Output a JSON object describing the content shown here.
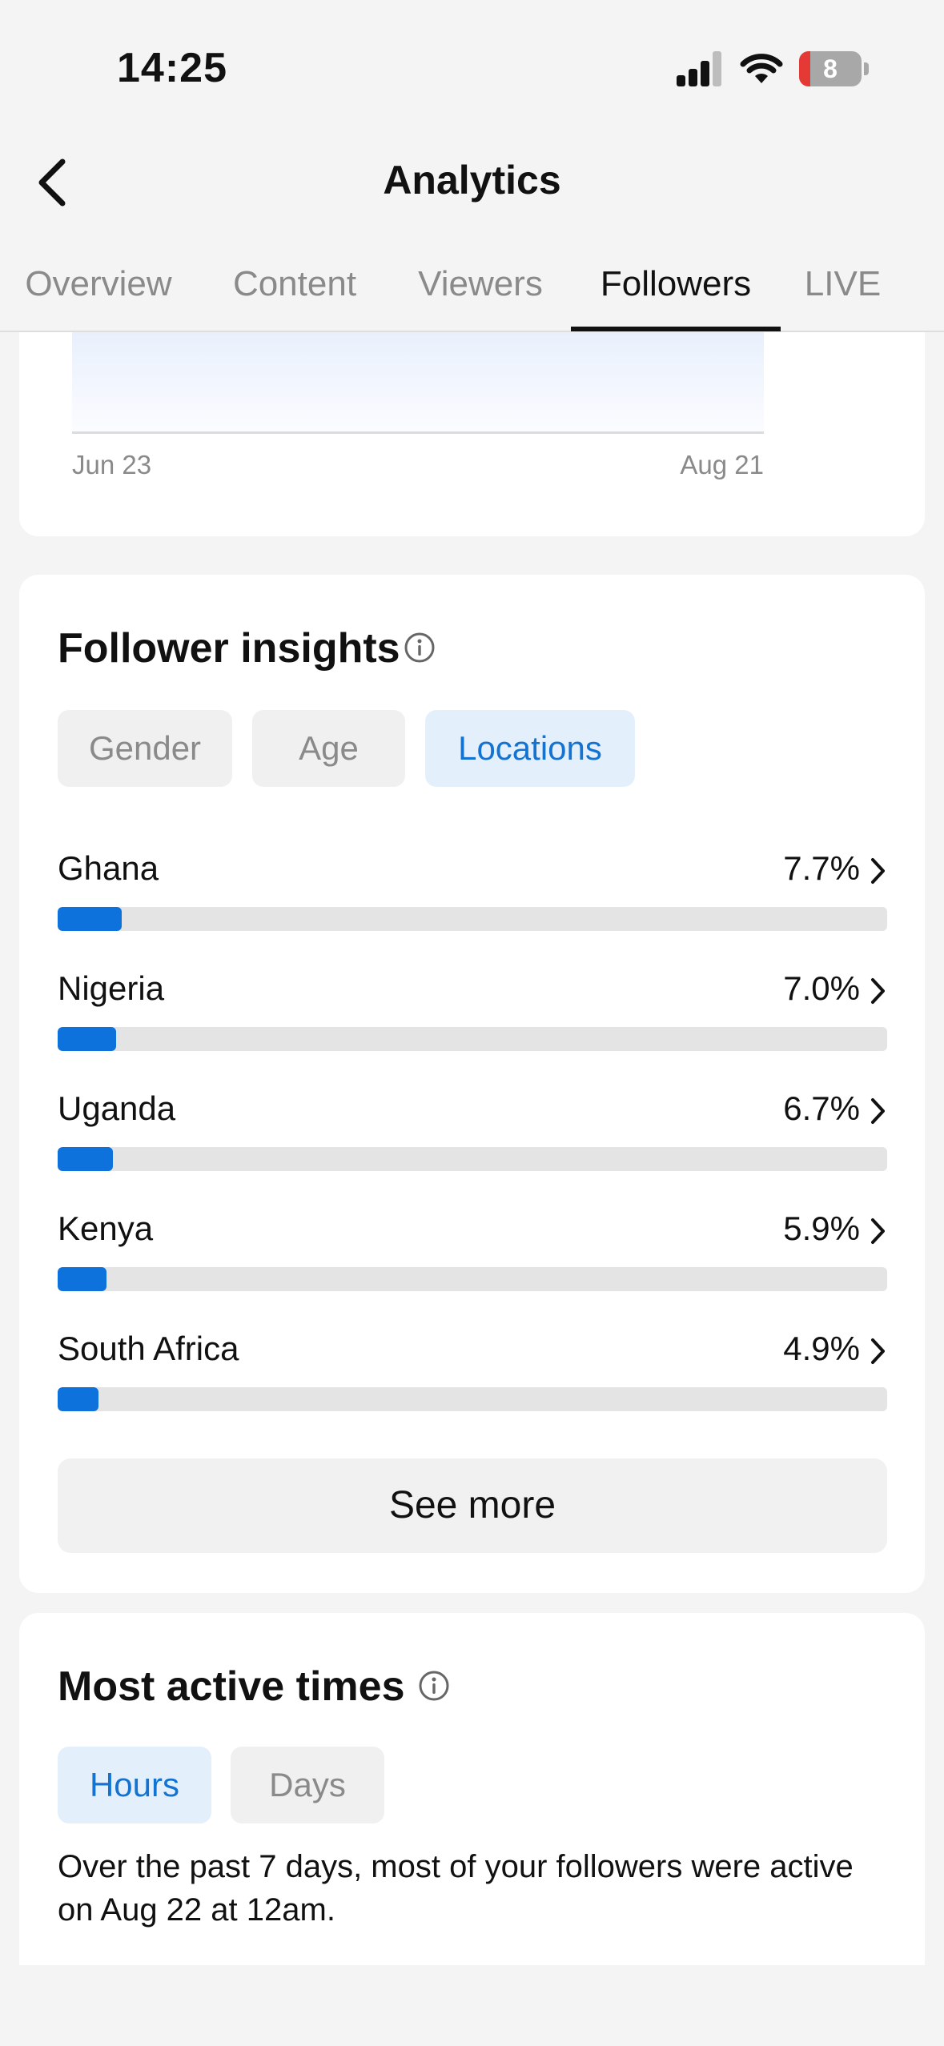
{
  "status_bar": {
    "time": "14:25",
    "battery_level": "8",
    "icons": [
      "cellular-signal-icon",
      "wifi-icon",
      "battery-icon"
    ]
  },
  "header": {
    "title": "Analytics",
    "back_icon": "chevron-left-icon"
  },
  "tabs": [
    {
      "label": "Overview",
      "active": false
    },
    {
      "label": "Content",
      "active": false
    },
    {
      "label": "Viewers",
      "active": false
    },
    {
      "label": "Followers",
      "active": true
    },
    {
      "label": "LIVE",
      "active": false
    }
  ],
  "chart": {
    "start_date": "Jun 23",
    "end_date": "Aug 21"
  },
  "follower_insights": {
    "title": "Follower insights",
    "info_icon": "info-icon",
    "filters": [
      {
        "label": "Gender",
        "selected": false
      },
      {
        "label": "Age",
        "selected": false
      },
      {
        "label": "Locations",
        "selected": true
      }
    ],
    "locations": [
      {
        "country": "Ghana",
        "percent_label": "7.7%",
        "percent": 7.7
      },
      {
        "country": "Nigeria",
        "percent_label": "7.0%",
        "percent": 7.0
      },
      {
        "country": "Uganda",
        "percent_label": "6.7%",
        "percent": 6.7
      },
      {
        "country": "Kenya",
        "percent_label": "5.9%",
        "percent": 5.9
      },
      {
        "country": "South Africa",
        "percent_label": "4.9%",
        "percent": 4.9
      }
    ],
    "see_more_label": "See more"
  },
  "most_active_times": {
    "title": "Most active times",
    "info_icon": "info-icon",
    "filters": [
      {
        "label": "Hours",
        "selected": true
      },
      {
        "label": "Days",
        "selected": false
      }
    ],
    "description": "Over the past 7 days, most of your followers were active on Aug 22 at 12am."
  },
  "colors": {
    "accent": "#0d72dc",
    "chip_selected_bg": "#e3f0fc",
    "chip_selected_text": "#1473d1",
    "background": "#f4f4f4",
    "battery_low": "#e53935"
  }
}
